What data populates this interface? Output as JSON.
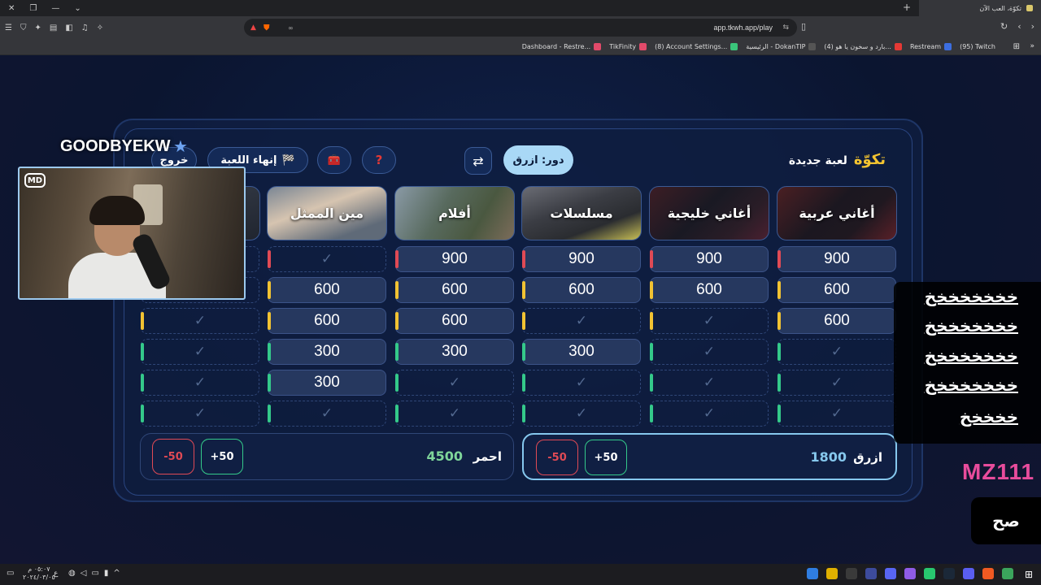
{
  "browser": {
    "tab_title": "تكوّة، العب الآن",
    "url": "app.tkwh.app/play",
    "bookmarks": [
      {
        "label": "Dashboard - Restre...",
        "color": "#e24a6a"
      },
      {
        "label": "TikFinity",
        "color": "#e24a6a"
      },
      {
        "label": "(8) Account Settings...",
        "color": "#3ac57a"
      },
      {
        "label": "الرئيسية - DokanTIP",
        "color": "#555"
      },
      {
        "label": "(4) بارد و سخون يا هو...",
        "color": "#e53935"
      },
      {
        "label": "Restream",
        "color": "#3c6ee0"
      },
      {
        "label": "(95) Twitch",
        "color": "#8b5cf6"
      }
    ]
  },
  "game": {
    "logo": "تكوّة",
    "new_game": "لعبة جديدة",
    "turn_label": "دور: ازرق",
    "end_game": "إنهاء اللعبة",
    "exit": "خروج",
    "help_glyph": "?",
    "toolbox_glyph": "🧰",
    "swap_glyph": "⇄",
    "flag_glyph": "🏁",
    "check": "✓",
    "categories": [
      {
        "name": "أغاني عربية",
        "cells": [
          "900",
          "600",
          "600",
          "✓",
          "✓",
          "✓"
        ]
      },
      {
        "name": "أغاني خليجية",
        "cells": [
          "900",
          "600",
          "✓",
          "✓",
          "✓",
          "✓"
        ]
      },
      {
        "name": "مسلسلات",
        "cells": [
          "900",
          "600",
          "✓",
          "300",
          "✓",
          "✓"
        ]
      },
      {
        "name": "أفلام",
        "cells": [
          "900",
          "600",
          "600",
          "300",
          "✓",
          "✓"
        ]
      },
      {
        "name": "مين الممثل",
        "cells": [
          "✓",
          "600",
          "600",
          "300",
          "300",
          "✓"
        ]
      },
      {
        "name": "",
        "cells": [
          "✓",
          "✓",
          "✓",
          "✓",
          "✓",
          "✓"
        ]
      }
    ],
    "teams": {
      "blue": {
        "name": "ازرق",
        "score": "1800",
        "score_color": "#86c8ee",
        "plus": "+50",
        "minus": "-50"
      },
      "red": {
        "name": "احمر",
        "score": "4500",
        "score_color": "#7fd69a",
        "plus": "+50",
        "minus": "-50"
      }
    }
  },
  "stream": {
    "streamer": "GOODBYEKW",
    "webcam_logo": "MD",
    "chat_lines": [
      "خخخخخخخخ",
      "خخخخخخخخ",
      "خخخخخخخخ",
      "خخخخخخخخ",
      "خخخخخ"
    ],
    "mod_name": "MZ111",
    "message": "صح"
  },
  "taskbar": {
    "time": "٠٥:٠٧ م",
    "date": "٢٠٢٤/٠٣/٠٥",
    "lang": "ع"
  }
}
